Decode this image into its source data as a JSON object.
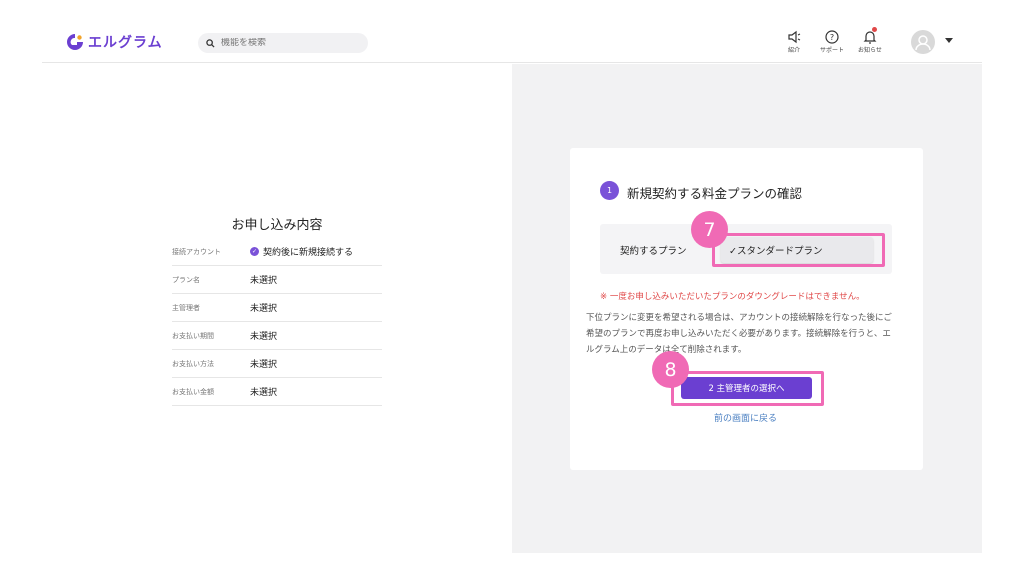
{
  "header": {
    "logo_text": "エルグラム",
    "search_placeholder": "機能を検索",
    "icons": [
      {
        "name": "megaphone-icon",
        "label": "紹介"
      },
      {
        "name": "help-icon",
        "label": "サポート"
      },
      {
        "name": "bell-icon",
        "label": "お知らせ"
      }
    ]
  },
  "summary": {
    "title": "お申し込み内容",
    "rows": [
      {
        "key": "接続アカウント",
        "value": "契約後に新規接続する",
        "checked": true
      },
      {
        "key": "プラン名",
        "value": "未選択"
      },
      {
        "key": "主管理者",
        "value": "未選択"
      },
      {
        "key": "お支払い期間",
        "value": "未選択"
      },
      {
        "key": "お支払い方法",
        "value": "未選択"
      },
      {
        "key": "お支払い金額",
        "value": "未選択"
      }
    ]
  },
  "step": {
    "number": "1",
    "title": "新規契約する料金プランの確認",
    "plan_label": "契約するプラン",
    "plan_selected": "✓スタンダードプラン",
    "warning": "※ 一度お申し込みいただいたプランのダウングレードはできません。",
    "note": "下位プランに変更を希望される場合は、アカウントの接続解除を行なった後にご希望のプランで再度お申し込みいただく必要があります。接続解除を行うと、エルグラム上のデータは全て削除されます。",
    "next_button": "2 主管理者の選択へ",
    "back_link": "前の画面に戻る"
  },
  "annotations": {
    "badge_7": "7",
    "badge_8": "8"
  },
  "colors": {
    "brand": "#6b3fd1",
    "highlight": "#f06ab5",
    "warning": "#e04848"
  }
}
